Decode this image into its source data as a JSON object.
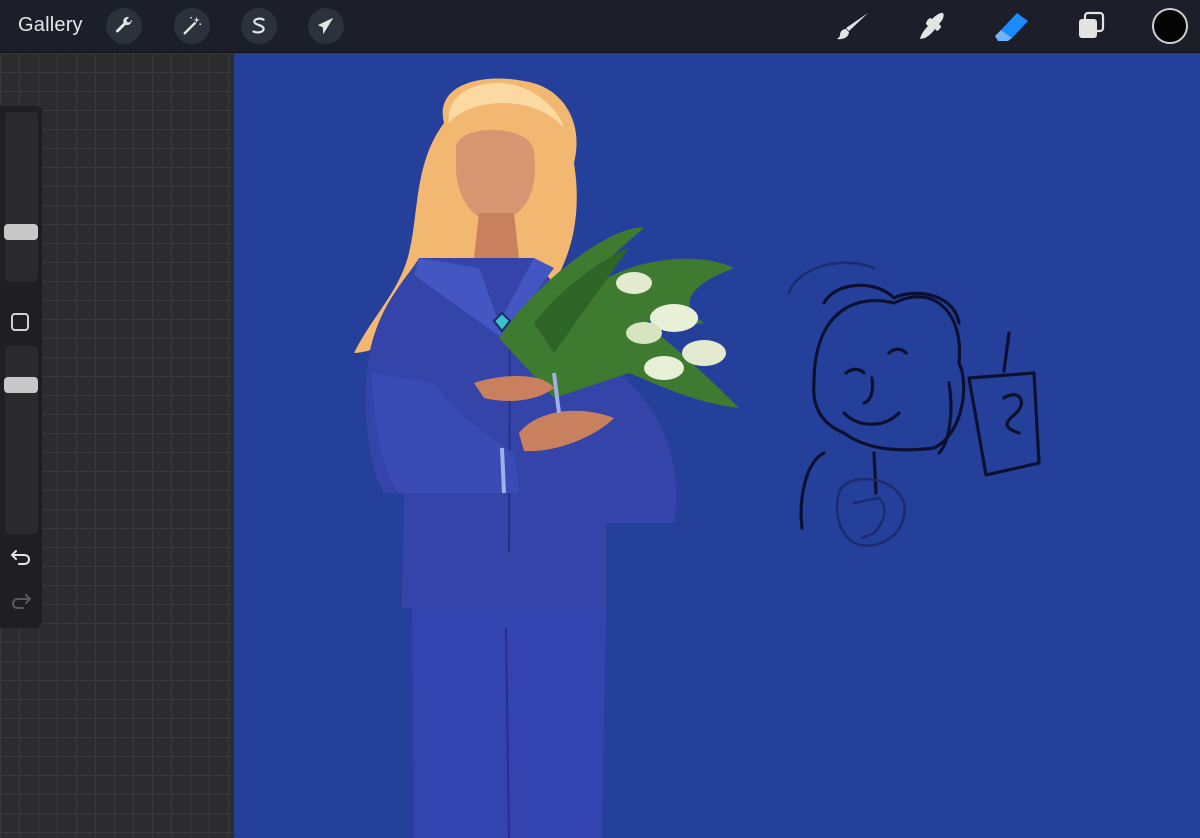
{
  "app": {
    "gallery_label": "Gallery"
  },
  "toolbar_left": {
    "items": [
      {
        "name": "actions",
        "icon": "wrench-icon"
      },
      {
        "name": "adjustments",
        "icon": "magic-wand-icon"
      },
      {
        "name": "selection",
        "icon": "selection-s-icon"
      },
      {
        "name": "transform",
        "icon": "arrow-cursor-icon"
      }
    ]
  },
  "toolbar_right": {
    "items": [
      {
        "name": "brush",
        "icon": "brush-icon",
        "active": false
      },
      {
        "name": "smudge",
        "icon": "smudge-icon",
        "active": false
      },
      {
        "name": "eraser",
        "icon": "eraser-icon",
        "active": true
      },
      {
        "name": "layers",
        "icon": "layers-icon",
        "active": false
      }
    ],
    "current_color": "#050505"
  },
  "sidebar": {
    "brush_size_level": 0.27,
    "opacity_level": 0.82,
    "modifier_icon": "square-icon",
    "undo_icon": "undo-icon",
    "redo_icon": "redo-icon"
  },
  "colors": {
    "canvas_background": "#25409a",
    "accent_active": "#1a8cff",
    "topbar": "#1c1f2a"
  }
}
